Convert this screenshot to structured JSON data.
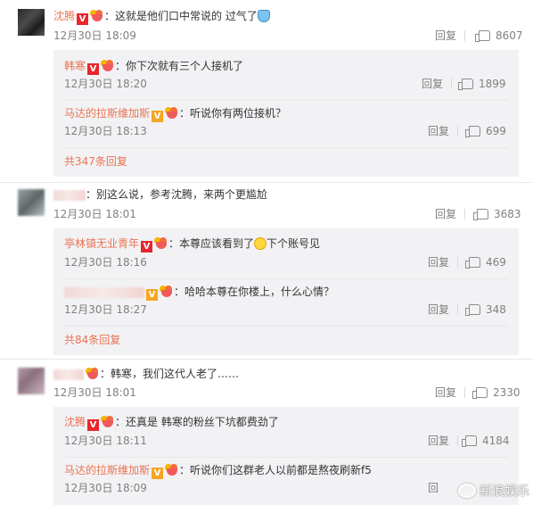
{
  "threads": [
    {
      "comment": {
        "user": "沈腾",
        "text": "：这就是他们口中常说的 过气了",
        "date": "12月30日 18:09",
        "reply": "回复",
        "likes": "8607"
      },
      "subs": [
        {
          "user": "韩寒",
          "text": "：你下次就有三个人接机了",
          "date": "12月30日 18:20",
          "reply": "回复",
          "likes": "1899"
        },
        {
          "user": "马达的拉斯维加斯",
          "text": "：听说你有两位接机？",
          "date": "12月30日 18:13",
          "reply": "回复",
          "likes": "699"
        }
      ],
      "more": "共347条回复"
    },
    {
      "comment": {
        "user": "",
        "text": "：别这么说，参考沈腾，来两个更尴尬",
        "date": "12月30日 18:01",
        "reply": "回复",
        "likes": "3683"
      },
      "subs": [
        {
          "user": "亭林镇无业青年",
          "text": "：本尊应该看到了",
          "text_after": "下个账号见",
          "date": "12月30日 18:16",
          "reply": "回复",
          "likes": "469"
        },
        {
          "user": "",
          "text": "：哈哈本尊在你楼上，什么心情？",
          "date": "12月30日 18:27",
          "reply": "回复",
          "likes": "348"
        }
      ],
      "more": "共84条回复"
    },
    {
      "comment": {
        "user": "",
        "text": "：韩寒，我们这代人老了……",
        "date": "12月30日 18:01",
        "reply": "回复",
        "likes": "2330"
      },
      "subs": [
        {
          "user": "沈腾",
          "text": "：还真是 韩寒的粉丝下坑都费劲了",
          "date": "12月30日 18:11",
          "reply": "回复",
          "likes": "4184"
        },
        {
          "user": "马达的拉斯维加斯",
          "text": "：听说你们这群老人以前都是熬夜刷新f5",
          "date": "12月30日 18:09",
          "reply": "回",
          "likes": ""
        }
      ]
    }
  ],
  "badges": {
    "v": "V"
  },
  "watermark": "新浪娱乐",
  "colors": {
    "username": "#eb7350",
    "meta": "#808080",
    "subbox": "#f2f2f5"
  }
}
